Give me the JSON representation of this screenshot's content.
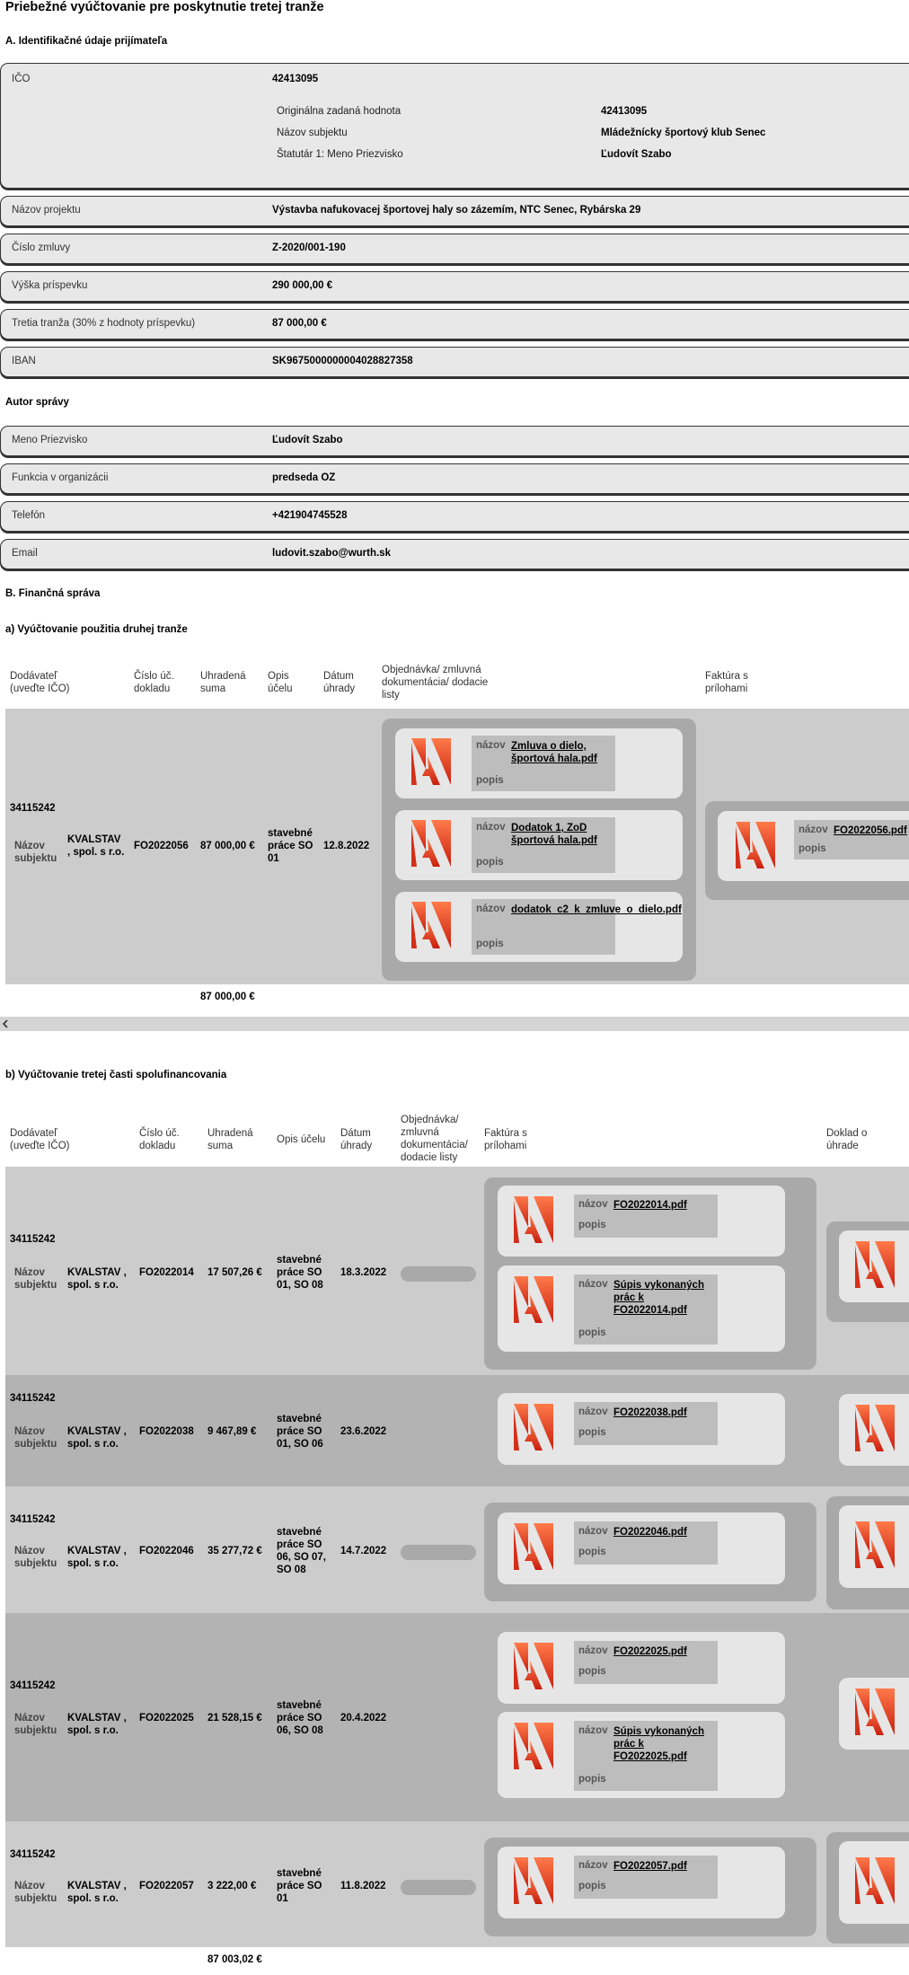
{
  "page_title": "Priebežné vyúčtovanie pre poskytnutie tretej tranže",
  "section_a": {
    "title": "A. Identifikačné údaje prijímateľa",
    "ico_label": "IČO",
    "ico_value": "42413095",
    "sub": [
      {
        "label": "Originálna zadaná hodnota",
        "value": "42413095"
      },
      {
        "label": "Názov subjektu",
        "value": "Mládežnícky športový klub Senec"
      },
      {
        "label": "Štatutár 1: Meno Priezvisko",
        "value": "Ľudovít Szabo"
      }
    ],
    "rows": [
      {
        "label": "Názov projektu",
        "value": "Výstavba nafukovacej športovej haly so zázemím, NTC Senec, Rybárska 29"
      },
      {
        "label": "Číslo zmluvy",
        "value": "Z-2020/001-190"
      },
      {
        "label": "Výška príspevku",
        "value": "290 000,00 €"
      },
      {
        "label": "Tretia tranža (30% z hodnoty príspevku)",
        "value": "87 000,00 €"
      },
      {
        "label": "IBAN",
        "value": "SK9675000000004028827358"
      }
    ]
  },
  "author": {
    "title": "Autor správy",
    "rows": [
      {
        "label": "Meno Priezvisko",
        "value": "Ľudovít Szabo"
      },
      {
        "label": "Funkcia v organizácii",
        "value": "predseda OZ"
      },
      {
        "label": "Telefón",
        "value": "+421904745528"
      },
      {
        "label": "Email",
        "value": "ludovit.szabo@wurth.sk"
      }
    ]
  },
  "section_b": {
    "title": "B. Finančná správa",
    "a_title": "a) Vyúčtovanie použitia druhej tranže",
    "b_title": "b) Vyúčtovanie tretej časti spolufinancovania"
  },
  "labels": {
    "nazov": "názov",
    "popis": "popis",
    "nazov_subjektu": "Názov subjektu"
  },
  "table_a": {
    "headers": {
      "dodavatel": "Dodávateľ (uveďte IČO)",
      "cislo": "Číslo úč. dokladu",
      "suma": "Uhradená suma",
      "opis": "Opis účelu",
      "datum": "Dátum úhrady",
      "objednavka": "Objednávka/ zmluvná dokumentácia/ dodacie listy",
      "faktura": "Faktúra s prílohami"
    },
    "row": {
      "ico": "34115242",
      "subjekt": "KVALSTAV , spol. s r.o.",
      "cislo": "FO2022056",
      "suma": "87 000,00 €",
      "opis": "stavebné práce SO 01",
      "datum": "12.8.2022",
      "docs": [
        "Zmluva o dielo, športová hala.pdf",
        "Dodatok 1, ZoD športová hala.pdf",
        "dodatok_c2_k_zmluve_o_dielo.pdf"
      ],
      "faktura": "FO2022056.pdf"
    },
    "total": "87 000,00 €"
  },
  "table_b": {
    "headers": {
      "dodavatel": "Dodávateľ (uveďte IČO)",
      "cislo": "Číslo úč. dokladu",
      "suma": "Uhradená suma",
      "opis": "Opis účelu",
      "datum": "Dátum úhrady",
      "objednavka": "Objednávka/ zmluvná dokumentácia/ dodacie listy",
      "faktura": "Faktúra s prílohami",
      "doklad": "Doklad o úhrade"
    },
    "rows": [
      {
        "ico": "34115242",
        "subjekt": "KVALSTAV , spol. s r.o.",
        "cislo": "FO2022014",
        "suma": "17 507,26 €",
        "opis": "stavebné práce SO 01, SO 08",
        "datum": "18.3.2022",
        "files": [
          "FO2022014.pdf",
          "Súpis vykonaných prác k FO2022014.pdf"
        ]
      },
      {
        "ico": "34115242",
        "subjekt": "KVALSTAV , spol. s r.o.",
        "cislo": "FO2022038",
        "suma": "9 467,89 €",
        "opis": "stavebné práce SO 01, SO 06",
        "datum": "23.6.2022",
        "files": [
          "FO2022038.pdf"
        ]
      },
      {
        "ico": "34115242",
        "subjekt": "KVALSTAV , spol. s r.o.",
        "cislo": "FO2022046",
        "suma": "35 277,72 €",
        "opis": "stavebné práce SO 06, SO 07, SO 08",
        "datum": "14.7.2022",
        "files": [
          "FO2022046.pdf"
        ]
      },
      {
        "ico": "34115242",
        "subjekt": "KVALSTAV , spol. s r.o.",
        "cislo": "FO2022025",
        "suma": "21 528,15 €",
        "opis": "stavebné práce SO 06, SO 08",
        "datum": "20.4.2022",
        "files": [
          "FO2022025.pdf",
          "Súpis vykonaných prác k FO2022025.pdf"
        ]
      },
      {
        "ico": "34115242",
        "subjekt": "KVALSTAV , spol. s r.o.",
        "cislo": "FO2022057",
        "suma": "3 222,00 €",
        "opis": "stavebné práce SO 01",
        "datum": "11.8.2022",
        "files": [
          "FO2022057.pdf"
        ]
      }
    ],
    "total": "87 003,02 €"
  }
}
